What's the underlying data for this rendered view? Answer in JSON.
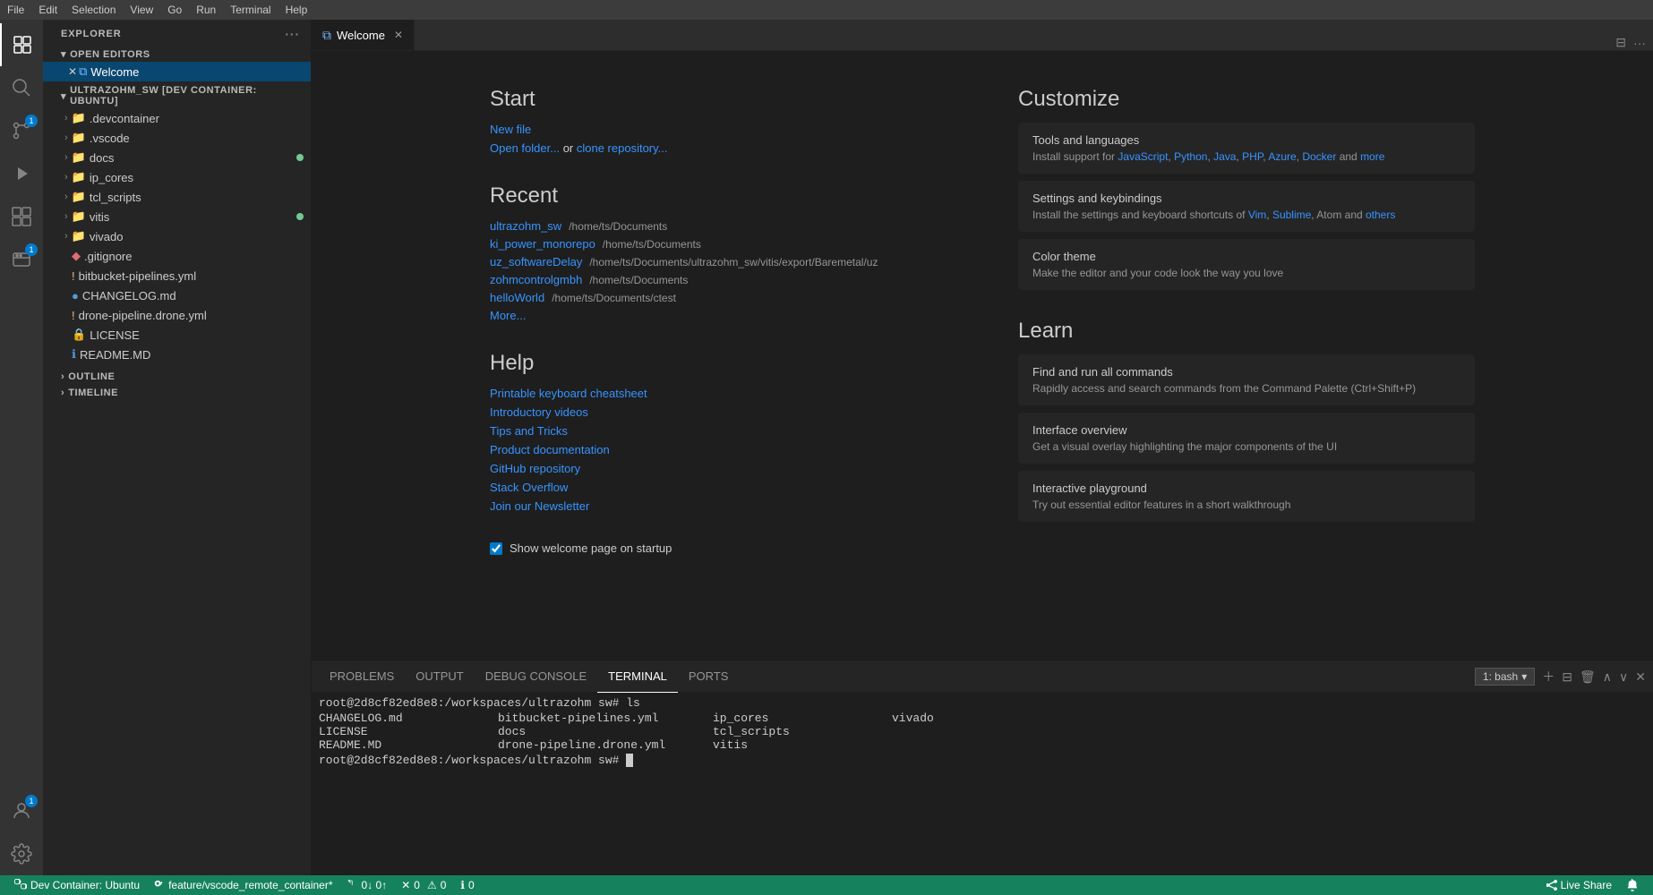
{
  "menubar": {
    "items": [
      "File",
      "Edit",
      "Selection",
      "View",
      "Go",
      "Run",
      "Terminal",
      "Help"
    ]
  },
  "activitybar": {
    "icons": [
      {
        "name": "explorer-icon",
        "symbol": "⧉",
        "active": true
      },
      {
        "name": "search-icon",
        "symbol": "🔍",
        "active": false
      },
      {
        "name": "source-control-icon",
        "symbol": "⑂",
        "active": false,
        "badge": "1"
      },
      {
        "name": "run-icon",
        "symbol": "▷",
        "active": false
      },
      {
        "name": "extensions-icon",
        "symbol": "⊞",
        "active": false
      },
      {
        "name": "remote-explorer-icon",
        "symbol": "⊡",
        "active": false
      }
    ],
    "bottom_icons": [
      {
        "name": "accounts-icon",
        "symbol": "👤",
        "badge": "1"
      },
      {
        "name": "settings-icon",
        "symbol": "⚙"
      }
    ]
  },
  "sidebar": {
    "title": "Explorer",
    "sections": {
      "open_editors": {
        "label": "Open Editors",
        "items": [
          {
            "name": "Welcome",
            "icon": "vscode",
            "active": true
          }
        ]
      },
      "workspace": {
        "label": "ULTRAZOHM_SW [DEV CONTAINER: UBUNTU]",
        "items": [
          {
            "name": ".devcontainer",
            "type": "folder",
            "indent": 1
          },
          {
            "name": ".vscode",
            "type": "folder",
            "indent": 1
          },
          {
            "name": "docs",
            "type": "folder",
            "indent": 1,
            "modified": true
          },
          {
            "name": "ip_cores",
            "type": "folder",
            "indent": 1
          },
          {
            "name": "tcl_scripts",
            "type": "folder",
            "indent": 1
          },
          {
            "name": "vitis",
            "type": "folder",
            "indent": 1,
            "modified": true
          },
          {
            "name": "vivado",
            "type": "folder",
            "indent": 1
          },
          {
            "name": ".gitignore",
            "type": "file-git",
            "indent": 1
          },
          {
            "name": "bitbucket-pipelines.yml",
            "type": "file-warning",
            "indent": 1
          },
          {
            "name": "CHANGELOG.md",
            "type": "file",
            "indent": 1
          },
          {
            "name": "drone-pipeline.drone.yml",
            "type": "file-warning",
            "indent": 1
          },
          {
            "name": "LICENSE",
            "type": "file-lock",
            "indent": 1
          },
          {
            "name": "README.MD",
            "type": "file-info",
            "indent": 1
          }
        ]
      },
      "outline": {
        "label": "Outline"
      },
      "timeline": {
        "label": "Timeline"
      }
    }
  },
  "tabs": [
    {
      "label": "Welcome",
      "icon": "vscode",
      "active": true,
      "closeable": true
    }
  ],
  "welcome": {
    "start": {
      "title": "Start",
      "new_file": "New file",
      "open_folder": "Open folder...",
      "or": " or ",
      "clone_repository": "clone repository..."
    },
    "recent": {
      "title": "Recent",
      "items": [
        {
          "name": "ultrazohm_sw",
          "path": "/home/ts/Documents"
        },
        {
          "name": "ki_power_monorepo",
          "path": "/home/ts/Documents"
        },
        {
          "name": "uz_softwareDelay",
          "path": "/home/ts/Documents/ultrazohm_sw/vitis/export/Baremetal/uz"
        },
        {
          "name": "zohmcontrolgmbh",
          "path": "/home/ts/Documents"
        },
        {
          "name": "helloWorld",
          "path": "/home/ts/Documents/ctest"
        }
      ],
      "more": "More..."
    },
    "help": {
      "title": "Help",
      "links": [
        "Printable keyboard cheatsheet",
        "Introductory videos",
        "Tips and Tricks",
        "Product documentation",
        "GitHub repository",
        "Stack Overflow",
        "Join our Newsletter"
      ]
    },
    "customize": {
      "title": "Customize",
      "cards": [
        {
          "title": "Tools and languages",
          "desc_before": "Install support for ",
          "links": [
            "JavaScript",
            "Python",
            "Java",
            "PHP",
            "Azure",
            "Docker"
          ],
          "desc_after": " and ",
          "more": "more"
        },
        {
          "title": "Settings and keybindings",
          "desc_before": "Install the settings and keyboard shortcuts of ",
          "links": [
            "Vim",
            "Sublime"
          ],
          "desc_after": ", Atom and ",
          "more": "others"
        },
        {
          "title": "Color theme",
          "desc": "Make the editor and your code look the way you love"
        }
      ]
    },
    "learn": {
      "title": "Learn",
      "cards": [
        {
          "title": "Find and run all commands",
          "desc": "Rapidly access and search commands from the Command Palette (Ctrl+Shift+P)"
        },
        {
          "title": "Interface overview",
          "desc": "Get a visual overlay highlighting the major components of the UI"
        },
        {
          "title": "Interactive playground",
          "desc": "Try out essential editor features in a short walkthrough"
        }
      ]
    },
    "show_welcome": "Show welcome page on startup"
  },
  "panel": {
    "tabs": [
      "PROBLEMS",
      "OUTPUT",
      "DEBUG CONSOLE",
      "TERMINAL",
      "PORTS"
    ],
    "active_tab": "TERMINAL",
    "terminal": {
      "bash_label": "1: bash",
      "lines": [
        "root@2d8cf82ed8e8:/workspaces/ultrazohm sw# ls",
        "",
        "",
        "root@2d8cf82ed8e8:/workspaces/ultrazohm sw# "
      ],
      "ls_cols": [
        [
          "CHANGELOG.md",
          "bitbucket-pipelines.yml",
          "ip_cores",
          "vivado"
        ],
        [
          "LICENSE",
          "docs",
          "tcl_scripts",
          ""
        ],
        [
          "README.MD",
          "drone-pipeline.drone.yml",
          "vitis",
          ""
        ]
      ]
    }
  },
  "statusbar": {
    "remote": "Dev Container: Ubuntu",
    "branch": "feature/vscode_remote_container*",
    "sync": "0↓ 0↑",
    "errors": "0",
    "warnings": "0",
    "info": "0",
    "live_share": "Live Share",
    "bell": ""
  }
}
